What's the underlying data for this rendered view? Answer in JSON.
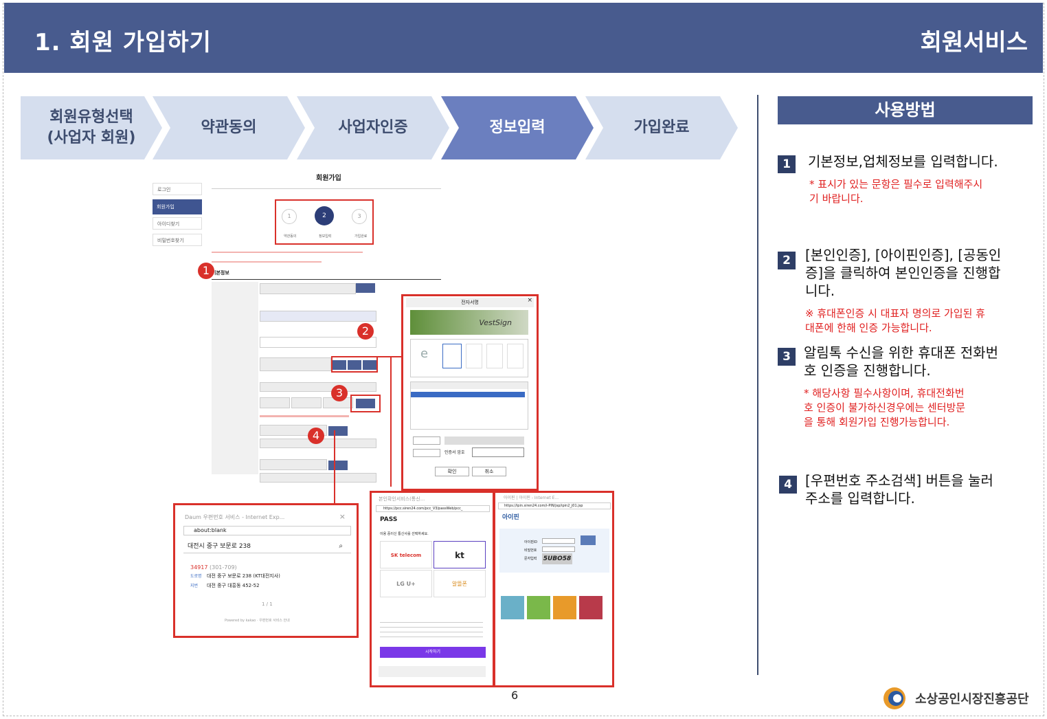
{
  "header": {
    "title": "1. 회원 가입하기",
    "service": "회원서비스"
  },
  "steps": [
    {
      "label": "회원유형선택\n(사업자 회원)"
    },
    {
      "label": "약관동의"
    },
    {
      "label": "사업자인증"
    },
    {
      "label": "정보입력"
    },
    {
      "label": "가입완료"
    }
  ],
  "usage": {
    "heading": "사용방법",
    "items": [
      {
        "num": "1",
        "text": "기본정보,업체정보를 입력합니다.",
        "note": "* 표시가 있는 문항은 필수로 입력해주시\n기 바랍니다."
      },
      {
        "num": "2",
        "text": "[본인인증], [아이핀인증], [공동인\n증]을 클릭하여 본인인증을 진행합\n니다.",
        "note": "※ 휴대폰인증 시 대표자 명의로 가입된 휴\n대폰에 한해 인증 가능합니다."
      },
      {
        "num": "3",
        "text": "알림톡 수신을 위한 휴대폰 전화번\n호 인증을 진행합니다.",
        "note": "* 해당사항 필수사항이며, 휴대전화번\n호 인증이 불가하신경우에는 센터방문\n을 통해 회원가입 진행가능합니다."
      },
      {
        "num": "4",
        "text": "[우편번호 주소검색] 버튼을 눌러\n주소를 입력합니다.",
        "note": ""
      }
    ]
  },
  "form": {
    "title": "회원가입",
    "sidebar": [
      "로그인",
      "회원가입",
      "아이디찾기",
      "비밀번호찾기"
    ],
    "stepper": [
      {
        "num": "1",
        "label": "약관동의"
      },
      {
        "num": "2",
        "label": "정보입력"
      },
      {
        "num": "3",
        "label": "가입완료"
      }
    ],
    "section": "기본정보",
    "badges": [
      "1",
      "2",
      "3",
      "4"
    ]
  },
  "vestsign": {
    "title": "전자서명",
    "brand": "VestSign",
    "btn_ok": "확인",
    "btn_cancel": "취소",
    "pw_label": "인증서 암호"
  },
  "daum": {
    "title": "Daum 우편번호 서비스 - Internet Exp...",
    "url": "about:blank",
    "query": "대전시 중구 보문로 238",
    "zip": "34917",
    "zip_old": "(301-709)",
    "road_tag": "도로명",
    "road": "대전 중구 보문로 238 (KT대전지사)",
    "jibun_tag": "지번",
    "jibun": "대전 중구 대흥동 452-52",
    "page": "1 / 1",
    "footer": "Powered by kakao · 우편번호 서비스 안내"
  },
  "pass": {
    "title": "본인확인서비스(통신...",
    "url": "https://pcc.siren24.com/pcc_V3/passWeb/pcc_",
    "brand": "PASS",
    "prompt": "이용 중이신 통신사를 선택하세요.",
    "carriers": [
      "SK telecom",
      "kt",
      "LG U+",
      "알뜰폰"
    ],
    "start": "시작하기"
  },
  "ipin": {
    "title": "아이핀 | 아이핀 - Internet E...",
    "url": "https://ipin.siren24.com/i-PIN/jsp/ipin2_j01.jsp",
    "brand": "아이핀",
    "id_label": "아이핀ID",
    "pw_label": "비밀번호",
    "captcha_label": "문자입력",
    "captcha": "5UBO58"
  },
  "footer": {
    "page": "6",
    "org": "소상공인시장진흥공단"
  },
  "colors": {
    "header": "#485b8e",
    "active_step": "#6b7fbf",
    "step": "#d5deee",
    "accent_red": "#d9302a"
  }
}
